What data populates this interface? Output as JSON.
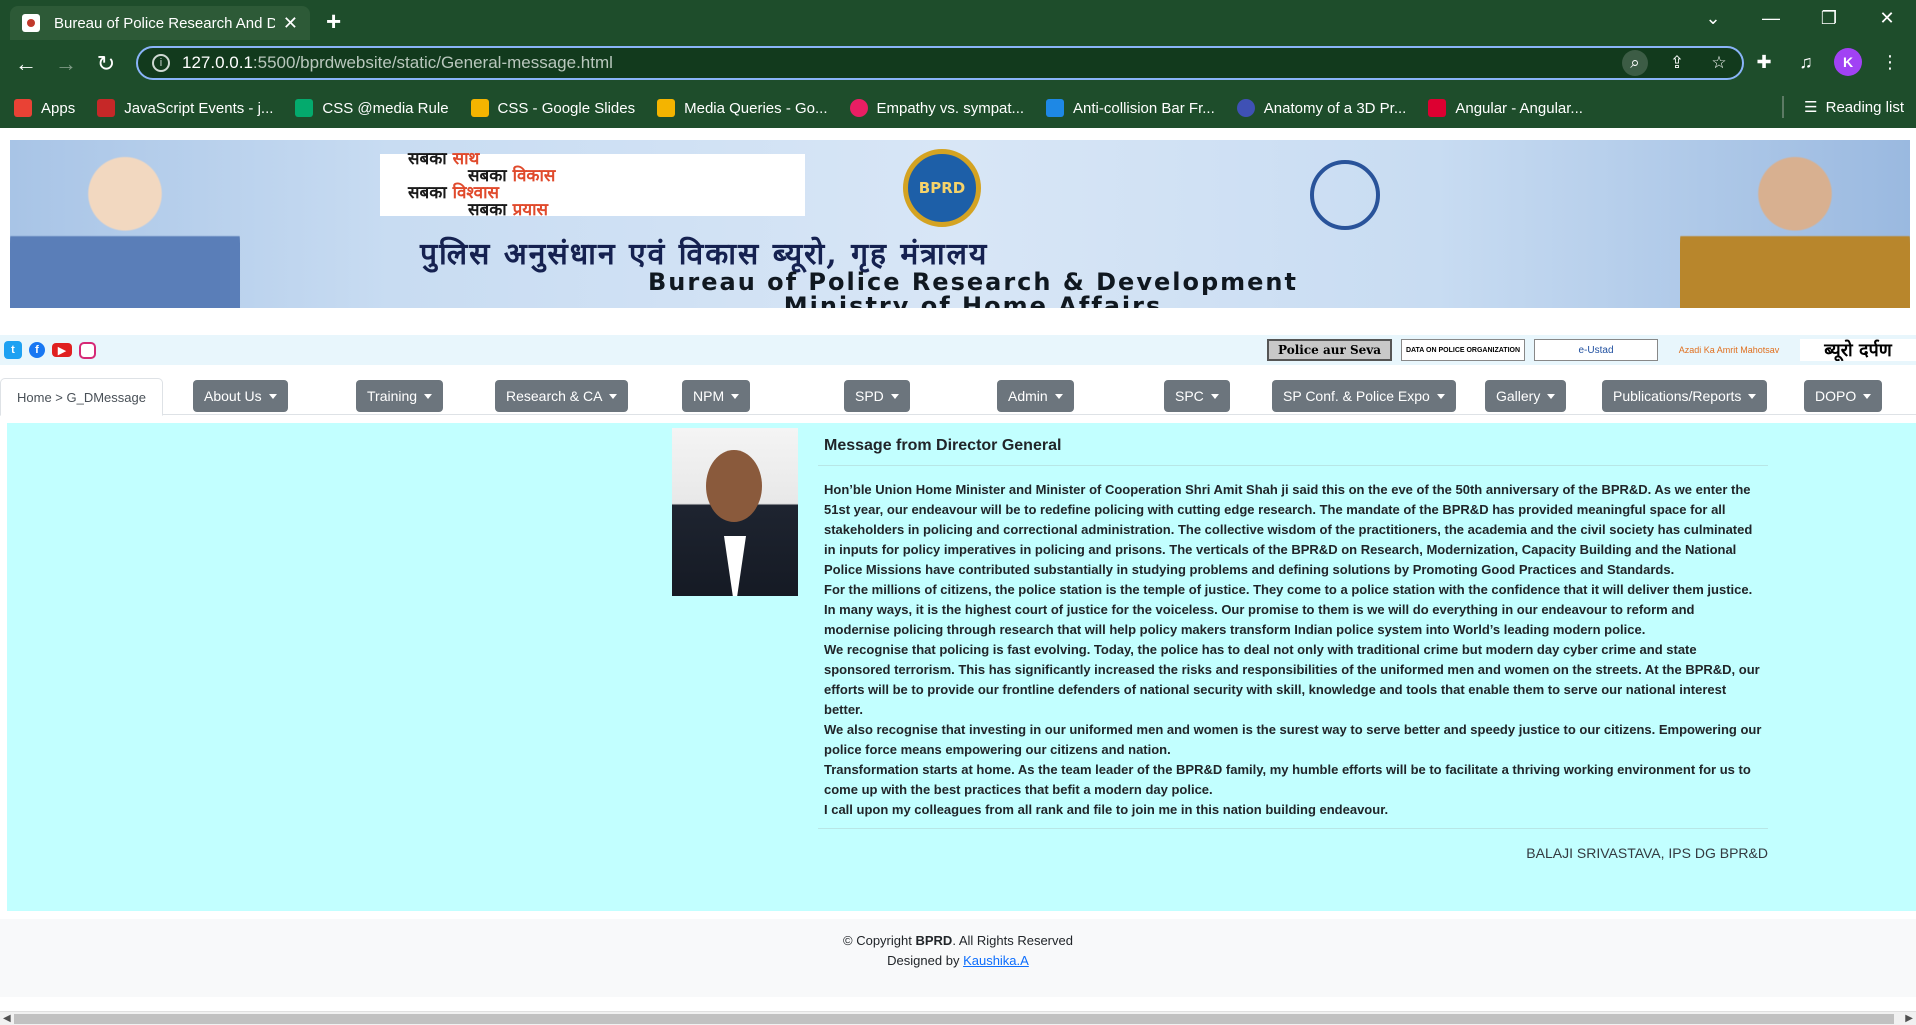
{
  "browser": {
    "tab_title": "Bureau of Police Research And Development",
    "url_host": "127.0.0.1",
    "url_path": ":5500/bprdwebsite/static/General-message.html",
    "profile_initial": "K",
    "bookmarks": [
      {
        "label": "Apps",
        "color": "#e94235"
      },
      {
        "label": "JavaScript Events - j...",
        "color": "#c62828"
      },
      {
        "label": "CSS @media Rule",
        "color": "#04aa6d"
      },
      {
        "label": "CSS - Google Slides",
        "color": "#f4b400"
      },
      {
        "label": "Media Queries - Go...",
        "color": "#f4b400"
      },
      {
        "label": "Empathy vs. sympat...",
        "color": "#e91e63"
      },
      {
        "label": "Anti-collision Bar Fr...",
        "color": "#1e88e5"
      },
      {
        "label": "Anatomy of a 3D Pr...",
        "color": "#3f51b5"
      },
      {
        "label": "Angular - Angular...",
        "color": "#dd0031"
      }
    ],
    "reading_list": "Reading list"
  },
  "banner": {
    "slogan": [
      {
        "plain": "सबका ",
        "accent": "साथ"
      },
      {
        "plain": "सबका ",
        "accent": "विकास"
      },
      {
        "plain": "सबका ",
        "accent": "विश्वास"
      },
      {
        "plain": "सबका ",
        "accent": "प्रयास"
      }
    ],
    "emblem_text": "BPRD",
    "hindi_title": "पुलिस अनुसंधान एवं विकास ब्यूरो, गृह मंत्रालय",
    "english_title_1": "Bureau of Police Research & Development",
    "english_title_2": "Ministry of Home Affairs"
  },
  "partners": {
    "police_aur_seva": "Police aur Seva",
    "data_on_police": "DATA ON POLICE ORGANIZATION",
    "e_ustad": "e-Ustad",
    "azadi": "Azadi Ka Amrit Mahotsav",
    "darpan": "ब्यूरो दर्पण"
  },
  "nav": {
    "breadcrumb": "Home > G_DMessage",
    "items": [
      "About Us",
      "Training",
      "Research & CA",
      "NPM",
      "SPD",
      "Admin",
      "SPC",
      "SP Conf. & Police Expo",
      "Gallery",
      "Publications/Reports",
      "DOPO"
    ]
  },
  "message": {
    "title": "Message from Director General",
    "paragraphs": [
      "Hon’ble Union Home Minister and Minister of Cooperation Shri Amit Shah ji said this on the eve of the 50th anniversary of the BPR&D. As we enter the 51st year, our endeavour will be to redefine policing with cutting edge research. The mandate of the BPR&D has provided meaningful space for all stakeholders in policing and correctional administration. The collective wisdom of the practitioners, the academia and the civil society has culminated in inputs for policy imperatives in policing and prisons. The verticals of the BPR&D on Research, Modernization, Capacity Building and the National Police Missions have contributed substantially in studying problems and defining solutions by Promoting Good Practices and Standards.",
      "For the millions of citizens, the police station is the temple of justice. They come to a police station with the confidence that it will deliver them justice. In many ways, it is the highest court of justice for the voiceless. Our promise to them is we will do everything in our endeavour to reform and modernise policing through research that will help policy makers transform Indian police system into World’s leading modern police.",
      "We recognise that policing is fast evolving. Today, the police has to deal not only with traditional crime but modern day cyber crime and state sponsored terrorism. This has significantly increased the risks and responsibilities of the uniformed men and women on the streets. At the BPR&D, our efforts will be to provide our frontline defenders of national security with skill, knowledge and tools that enable them to serve our national interest better.",
      "We also recognise that investing in our uniformed men and women is the surest way to serve better and speedy justice to our citizens. Empowering our police force means empowering our citizens and nation.",
      "Transformation starts at home. As the team leader of the BPR&D family, my humble efforts will be to facilitate a thriving working environment for us to come up with the best practices that befit a modern day police.",
      "I call upon my colleagues from all rank and file to join me in this nation building endeavour."
    ],
    "signature": "BALAJI SRIVASTAVA, IPS DG BPR&D"
  },
  "footer": {
    "copyright_prefix": "© Copyright ",
    "brand": "BPRD",
    "copyright_suffix": ". All Rights Reserved",
    "designed_by": "Designed by ",
    "designer": "Kaushika.A"
  }
}
